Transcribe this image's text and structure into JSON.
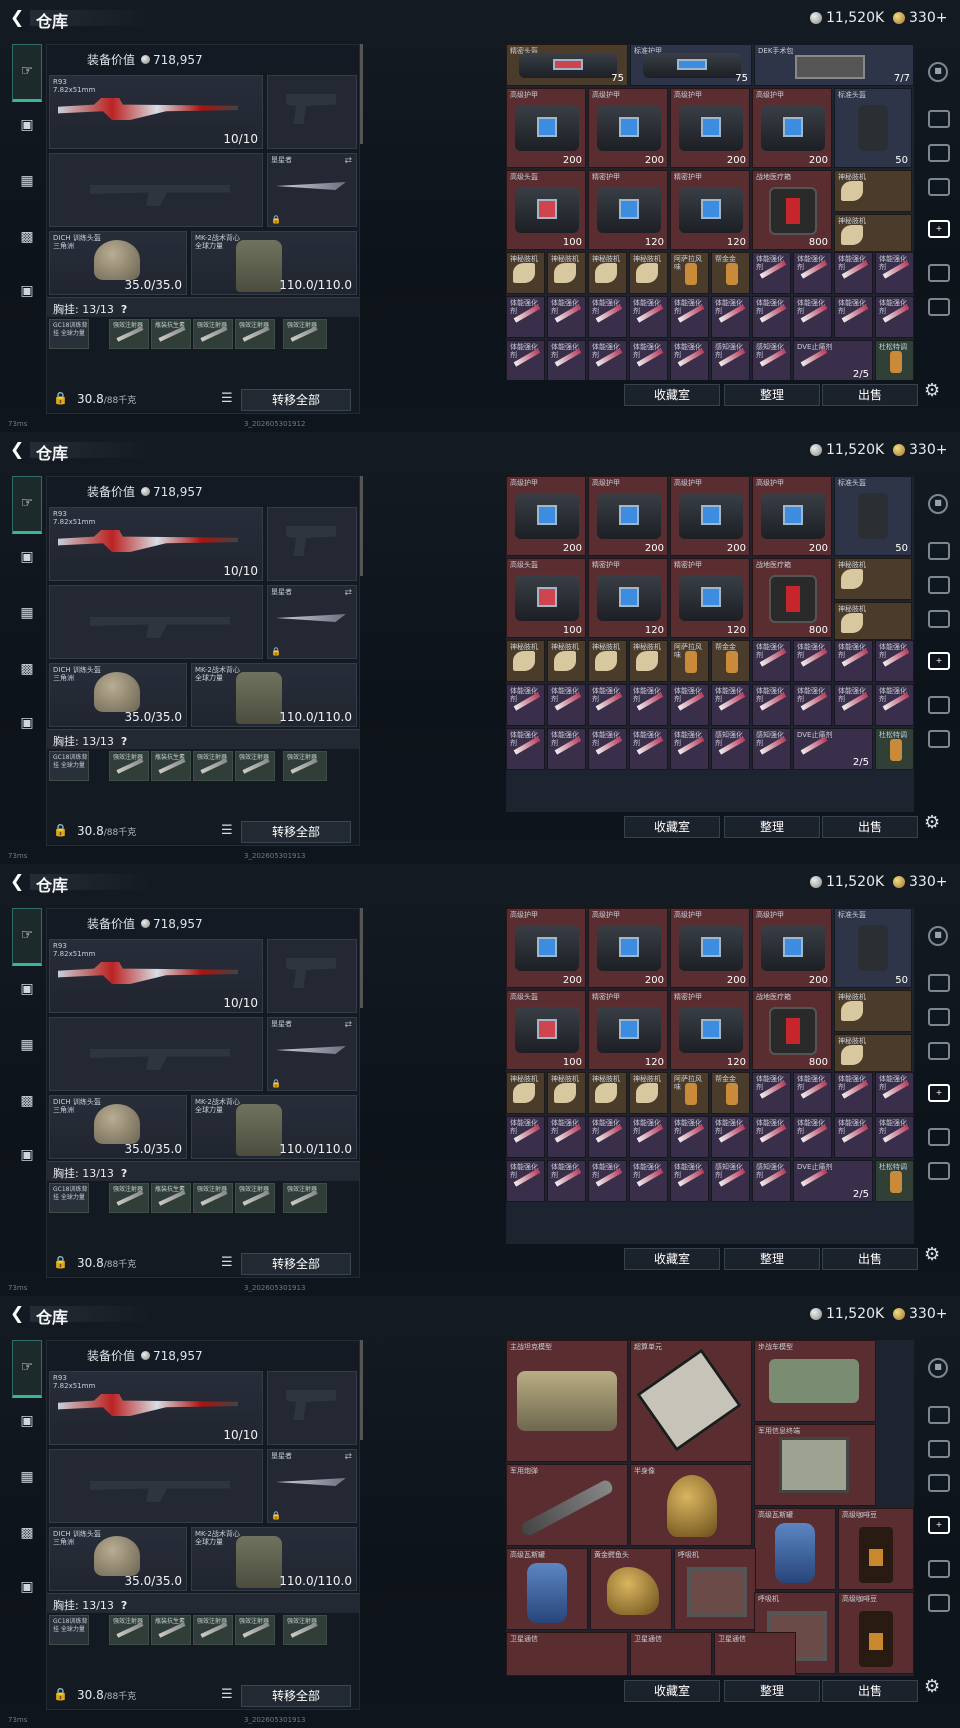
{
  "header": {
    "title": "仓库",
    "silver": "11,520K",
    "gold": "330+"
  },
  "equip": {
    "value_label": "装备价值",
    "value": "718,957",
    "primary": {
      "name": "R93",
      "caliber": "7.82x51mm",
      "ammo": "10/10"
    },
    "melee": {
      "name": "垦星者"
    },
    "helmet": {
      "name": "DICH 训练头盔",
      "sub": "三角洲",
      "dur": "35.0/35.0"
    },
    "armor": {
      "name": "MK-2战术背心",
      "sub": "全球力量",
      "dur": "110.0/110.0"
    },
    "chest_label": "胸挂:",
    "chest_count": "13/13",
    "chest_q": "?",
    "chest_items": [
      "GC18训练背挂 全球力量",
      "强效注射器",
      "瓶装抗生素",
      "强效注射器",
      "强效注射器"
    ],
    "weight": "30.8",
    "weight_max": "/88千克",
    "transfer": "转移全部"
  },
  "buttons": {
    "fav": "收藏室",
    "sort": "整理",
    "sell": "出售"
  },
  "status": {
    "ping": "73ms",
    "uid1": "3_202605301912",
    "uid2": "3_202605301913"
  },
  "labels": {
    "jingmi_tk": "精密头盔",
    "biaozhun_hj": "标准护甲",
    "dek": "DEK手术包",
    "gaoji_hj": "高级护甲",
    "biaozhun_tk": "标准头盔",
    "gaoji_tk": "高级头盔",
    "jingmi_hj": "精密护甲",
    "zhanchang_yl": "战地医疗箱",
    "shenmi_jj": "神秘肢机",
    "asapl": "阿萨拉风味",
    "bangjinjin": "帮金金",
    "tineng": "体能强化剂",
    "ganzhi": "感知强化剂",
    "dve": "DVE止痛剂",
    "dusong": "杜松特调",
    "tank": "主战坦克模型",
    "superchip": "超算单元",
    "ifv": "步战车模型",
    "army_case": "军用信息终端",
    "missile": "军用炮弹",
    "bust": "半身像",
    "gas_high": "高级瓦斯罐",
    "gold_croc": "黄金鳄鱼头",
    "breathe": "呼吸机",
    "coffee": "高级咖啡豆",
    "sat": "卫星通信"
  },
  "values": {
    "v75": "75",
    "v7_7": "7/7",
    "v200": "200",
    "v50": "50",
    "v100": "100",
    "v120": "120",
    "v800": "800",
    "v2_5": "2/5"
  },
  "icons": [
    "back-arrow-icon",
    "silver-coin-icon",
    "gold-coin-icon",
    "gun-icon",
    "vest-icon",
    "backpack-icon",
    "storage-icon",
    "briefcase-icon",
    "lock-icon",
    "list-icon",
    "settings-gear-icon"
  ]
}
